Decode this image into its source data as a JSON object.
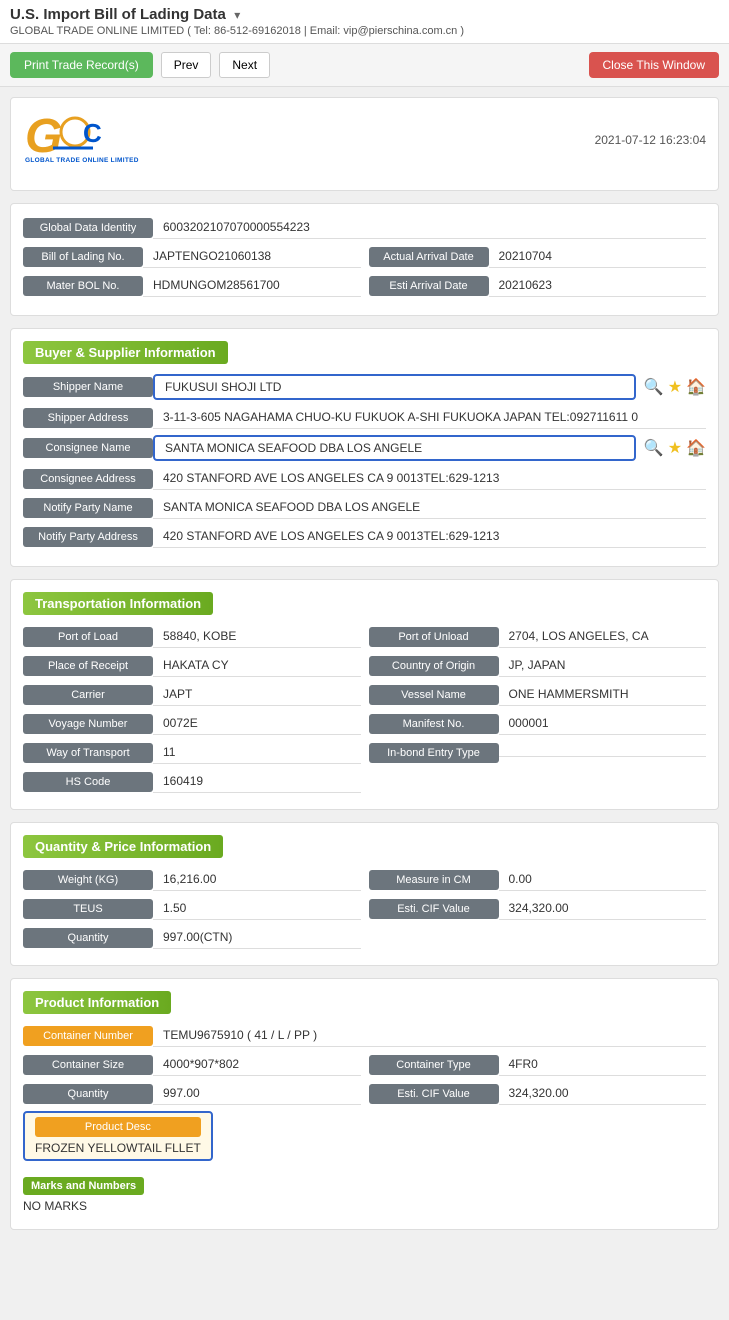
{
  "header": {
    "title": "U.S. Import Bill of Lading Data",
    "arrow": "▾",
    "company_info": "GLOBAL TRADE ONLINE LIMITED ( Tel: 86-512-69162018 | Email: vip@pierschina.com.cn )"
  },
  "toolbar": {
    "print_label": "Print Trade Record(s)",
    "prev_label": "Prev",
    "next_label": "Next",
    "close_label": "Close This Window"
  },
  "logo": {
    "company_name": "GLOBAL TRADE ONLINE LIMITED"
  },
  "timestamp": "2021-07-12 16:23:04",
  "basic_info": {
    "global_data_identity_label": "Global Data Identity",
    "global_data_identity_value": "6003202107070000554223",
    "bill_of_lading_label": "Bill of Lading No.",
    "bill_of_lading_value": "JAPTENGO21060138",
    "actual_arrival_label": "Actual Arrival Date",
    "actual_arrival_value": "20210704",
    "master_bol_label": "Mater BOL No.",
    "master_bol_value": "HDMUNGOM28561700",
    "esti_arrival_label": "Esti Arrival Date",
    "esti_arrival_value": "20210623"
  },
  "buyer_supplier": {
    "section_title": "Buyer & Supplier Information",
    "shipper_name_label": "Shipper Name",
    "shipper_name_value": "FUKUSUI SHOJI LTD",
    "shipper_address_label": "Shipper Address",
    "shipper_address_value": "3-11-3-605 NAGAHAMA CHUO-KU FUKUOK A-SHI FUKUOKA JAPAN TEL:092711611 0",
    "consignee_name_label": "Consignee Name",
    "consignee_name_value": "SANTA MONICA SEAFOOD DBA LOS ANGELE",
    "consignee_address_label": "Consignee Address",
    "consignee_address_value": "420 STANFORD AVE LOS ANGELES CA 9 0013TEL:629-1213",
    "notify_party_name_label": "Notify Party Name",
    "notify_party_name_value": "SANTA MONICA SEAFOOD DBA LOS ANGELE",
    "notify_party_address_label": "Notify Party Address",
    "notify_party_address_value": "420 STANFORD AVE LOS ANGELES CA 9 0013TEL:629-1213"
  },
  "transportation": {
    "section_title": "Transportation Information",
    "port_of_load_label": "Port of Load",
    "port_of_load_value": "58840, KOBE",
    "port_of_unload_label": "Port of Unload",
    "port_of_unload_value": "2704, LOS ANGELES, CA",
    "place_of_receipt_label": "Place of Receipt",
    "place_of_receipt_value": "HAKATA CY",
    "country_of_origin_label": "Country of Origin",
    "country_of_origin_value": "JP, JAPAN",
    "carrier_label": "Carrier",
    "carrier_value": "JAPT",
    "vessel_name_label": "Vessel Name",
    "vessel_name_value": "ONE HAMMERSMITH",
    "voyage_number_label": "Voyage Number",
    "voyage_number_value": "0072E",
    "manifest_no_label": "Manifest No.",
    "manifest_no_value": "000001",
    "way_of_transport_label": "Way of Transport",
    "way_of_transport_value": "11",
    "in_bond_entry_label": "In-bond Entry Type",
    "in_bond_entry_value": "",
    "hs_code_label": "HS Code",
    "hs_code_value": "160419"
  },
  "quantity_price": {
    "section_title": "Quantity & Price Information",
    "weight_label": "Weight (KG)",
    "weight_value": "16,216.00",
    "measure_label": "Measure in CM",
    "measure_value": "0.00",
    "teus_label": "TEUS",
    "teus_value": "1.50",
    "esti_cif_label": "Esti. CIF Value",
    "esti_cif_value": "324,320.00",
    "quantity_label": "Quantity",
    "quantity_value": "997.00(CTN)"
  },
  "product_info": {
    "section_title": "Product Information",
    "container_number_label": "Container Number",
    "container_number_value": "TEMU9675910 ( 41 / L / PP )",
    "container_size_label": "Container Size",
    "container_size_value": "4000*907*802",
    "container_type_label": "Container Type",
    "container_type_value": "4FR0",
    "quantity_label": "Quantity",
    "quantity_value": "997.00",
    "esti_cif_label": "Esti. CIF Value",
    "esti_cif_value": "324,320.00",
    "product_desc_label": "Product Desc",
    "product_desc_value": "FROZEN YELLOWTAIL FLLET",
    "marks_label": "Marks and Numbers",
    "marks_value": "NO MARKS"
  }
}
